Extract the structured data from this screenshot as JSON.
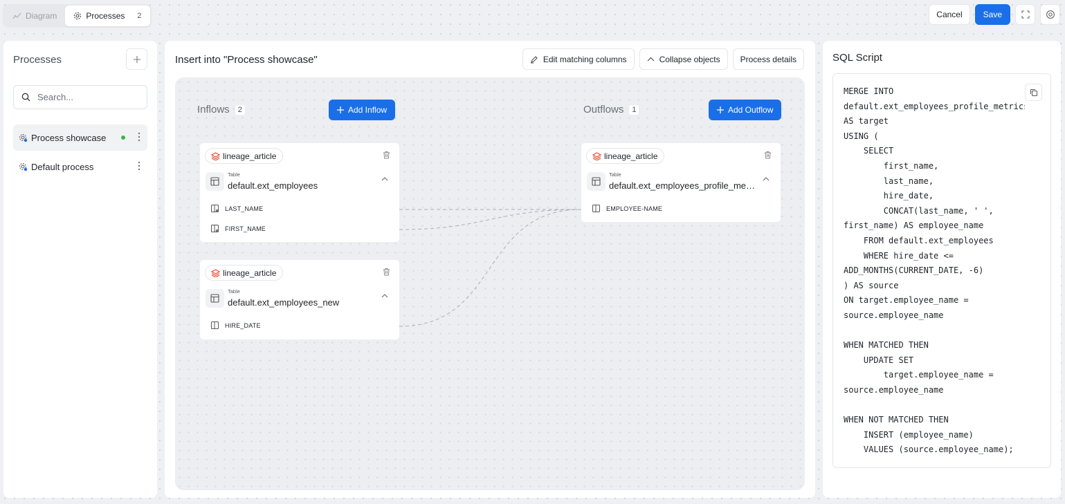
{
  "tabs": [
    {
      "label": "Diagram",
      "icon": "diagram-icon"
    },
    {
      "label": "Processes",
      "icon": "gear-icon",
      "count": "2"
    }
  ],
  "top_actions": {
    "cancel": "Cancel",
    "save": "Save"
  },
  "sidebar": {
    "title": "Processes",
    "search_placeholder": "Search...",
    "items": [
      {
        "label": "Process showcase",
        "active": true,
        "status": "active"
      },
      {
        "label": "Default process",
        "active": false
      }
    ]
  },
  "center": {
    "title": "Insert into \"Process showcase\"",
    "actions": {
      "edit_matching": "Edit matching columns",
      "collapse": "Collapse objects",
      "details": "Process details"
    },
    "inflows": {
      "label": "Inflows",
      "count": "2",
      "add_label": "Add Inflow"
    },
    "outflows": {
      "label": "Outflows",
      "count": "1",
      "add_label": "Add Outflow"
    },
    "inflow_nodes": [
      {
        "source": "lineage_article",
        "type": "Table",
        "name": "default.ext_employees",
        "columns": [
          "LAST_NAME",
          "FIRST_NAME"
        ]
      },
      {
        "source": "lineage_article",
        "type": "Table",
        "name": "default.ext_employees_new",
        "columns": [
          "HIRE_DATE"
        ]
      }
    ],
    "outflow_nodes": [
      {
        "source": "lineage_article",
        "type": "Table",
        "name": "default.ext_employees_profile_metrics",
        "columns": [
          "EMPLOYEE-NAME"
        ]
      }
    ]
  },
  "sql": {
    "title": "SQL Script",
    "script": "MERGE INTO\ndefault.ext_employees_profile_metrics\nAS target\nUSING (\n    SELECT\n        first_name,\n        last_name,\n        hire_date,\n        CONCAT(last_name, ' ',\nfirst_name) AS employee_name\n    FROM default.ext_employees\n    WHERE hire_date <=\nADD_MONTHS(CURRENT_DATE, -6)\n) AS source\nON target.employee_name =\nsource.employee_name\n\nWHEN MATCHED THEN\n    UPDATE SET\n        target.employee_name =\nsource.employee_name\n\nWHEN NOT MATCHED THEN\n    INSERT (employee_name)\n    VALUES (source.employee_name);"
  },
  "colors": {
    "accent": "#1a6fe8",
    "status_active": "#3cb44b",
    "source_badge": "#e8452c"
  }
}
